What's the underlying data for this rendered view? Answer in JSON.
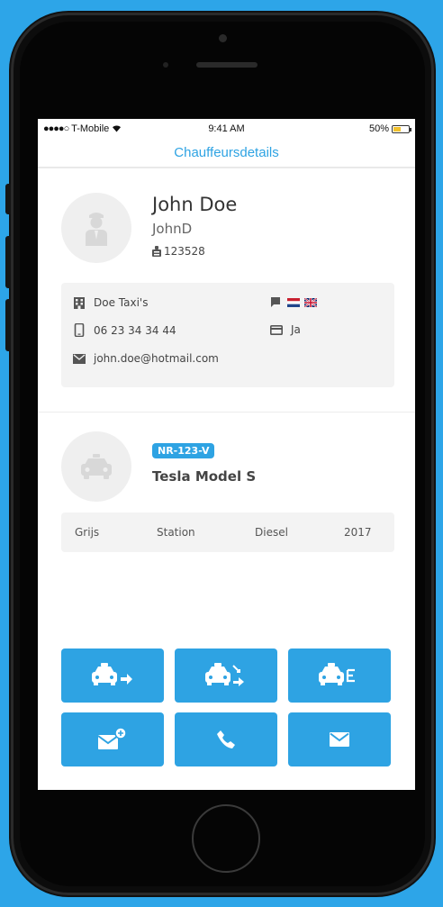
{
  "status_bar": {
    "carrier": "T-Mobile",
    "time": "9:41 AM",
    "battery": "50%",
    "battery_level": 0.5
  },
  "nav": {
    "title": "Chauffeursdetails"
  },
  "driver": {
    "name": "John Doe",
    "username": "JohnD",
    "id": "123528",
    "company": "Doe Taxi's",
    "phone": "06 23 34 34 44",
    "email": "john.doe@hotmail.com",
    "payment": "Ja",
    "languages": [
      "nl-flag-icon",
      "uk-flag-icon"
    ]
  },
  "vehicle": {
    "plate": "NR-123-V",
    "model": "Tesla Model S",
    "color": "Grijs",
    "body": "Station",
    "fuel": "Diesel",
    "year": "2017"
  },
  "actions": [
    {
      "icon": "taxi-send-icon"
    },
    {
      "icon": "taxi-transfer-icon"
    },
    {
      "icon": "taxi-e-icon"
    },
    {
      "icon": "message-add-icon"
    },
    {
      "icon": "phone-icon"
    },
    {
      "icon": "mail-icon"
    }
  ],
  "colors": {
    "accent": "#2ea3e3",
    "background": "#2da5e8",
    "card": "#f3f3f3"
  }
}
